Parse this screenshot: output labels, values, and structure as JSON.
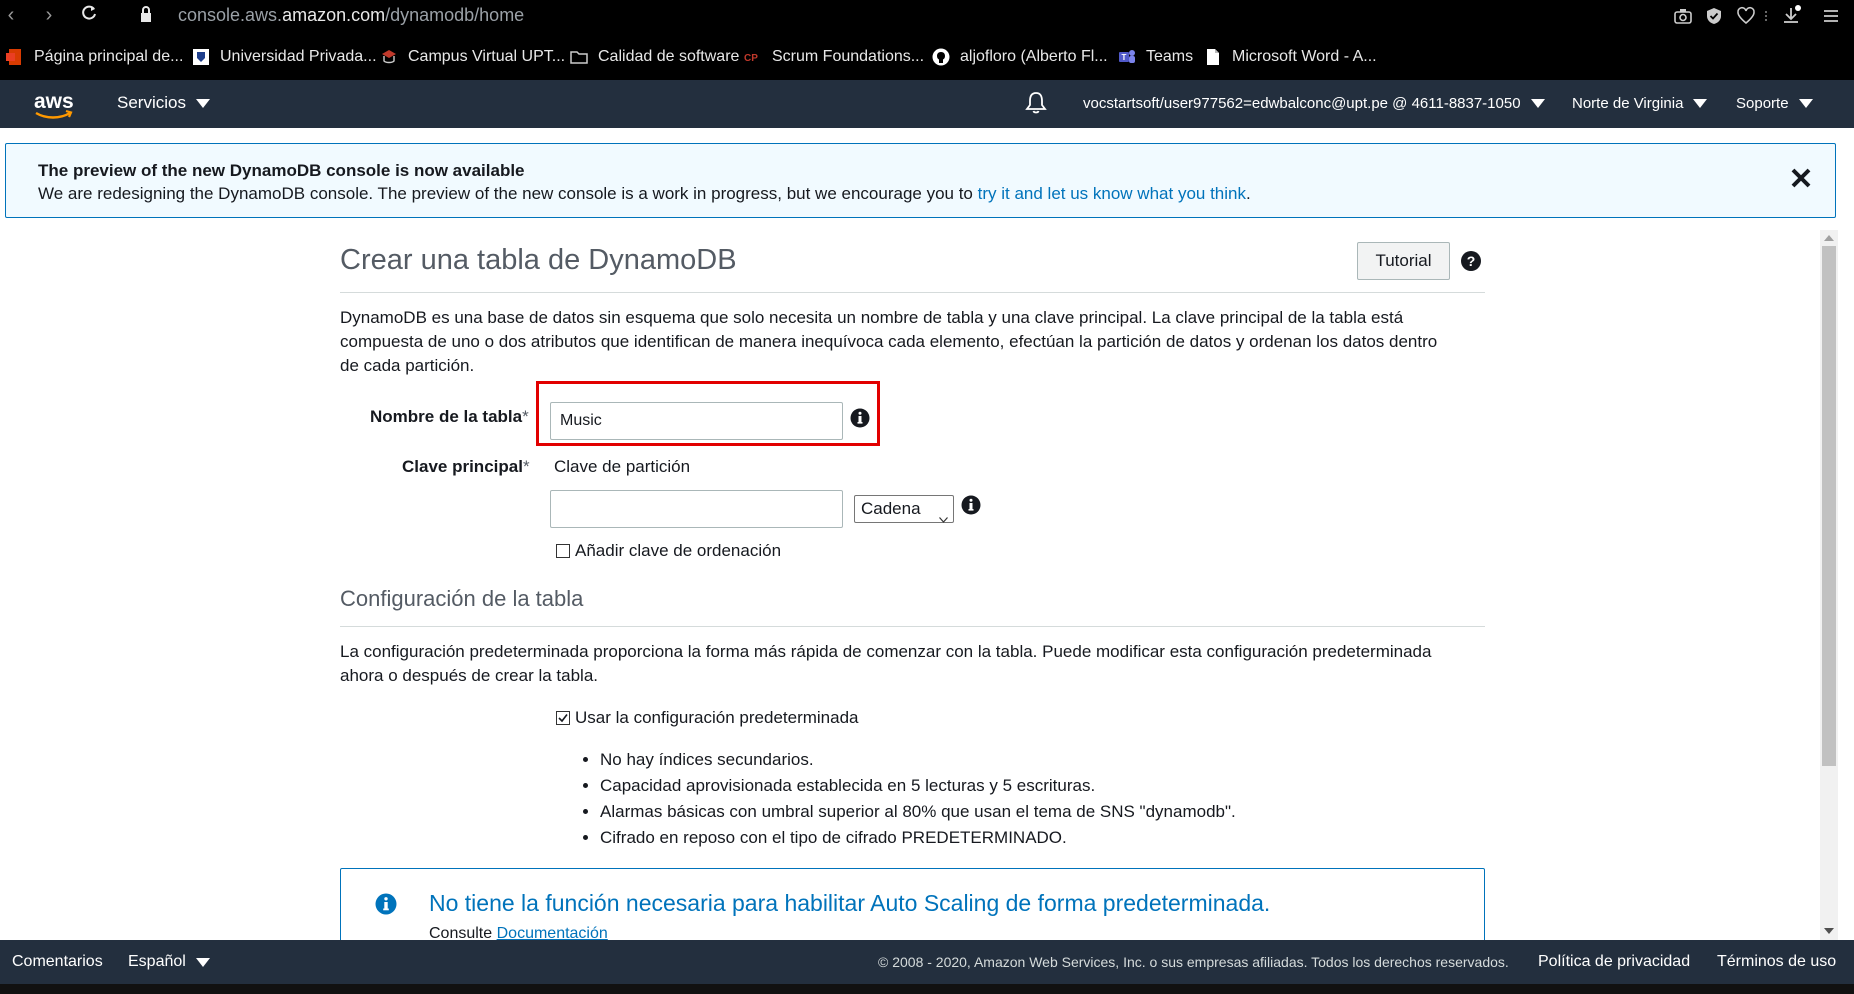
{
  "browser": {
    "url_prefix": "console.aws.",
    "url_domain": "amazon.com",
    "url_path": "/dynamodb/home",
    "bookmarks": [
      {
        "label": "Página principal de...",
        "icon": "office-icon"
      },
      {
        "label": "Universidad Privada...",
        "icon": "university-crest-icon"
      },
      {
        "label": "Campus Virtual UPT...",
        "icon": "campus-icon"
      },
      {
        "label": "Calidad de software",
        "icon": "folder-icon"
      },
      {
        "label": "Scrum Foundations...",
        "icon": "cp-icon"
      },
      {
        "label": "aljofloro (Alberto Fl...",
        "icon": "github-icon"
      },
      {
        "label": "Teams",
        "icon": "teams-icon"
      },
      {
        "label": "Microsoft Word - A...",
        "icon": "document-icon"
      }
    ]
  },
  "aws_nav": {
    "logo_text": "aws",
    "services": "Servicios",
    "account": "vocstartsoft/user977562=edwbalconc@upt.pe @ 4611-8837-1050",
    "region": "Norte de Virginia",
    "support": "Soporte"
  },
  "banner": {
    "title": "The preview of the new DynamoDB console is now available",
    "text": "We are redesigning the DynamoDB console. The preview of the new console is a work in progress, but we encourage you to",
    "link": "try it and let us know what you think",
    "period": "."
  },
  "page": {
    "title": "Crear una tabla de DynamoDB",
    "tutorial_button": "Tutorial",
    "description_lines": [
      "DynamoDB es una base de datos sin esquema que solo necesita un nombre de tabla y una clave principal. La clave principal de la tabla está",
      "compuesta de uno o dos atributos que identifican de manera inequívoca cada elemento, efectúan la partición de datos y ordenan los datos dentro",
      "de cada partición."
    ]
  },
  "form": {
    "table_name_label": "Nombre de la tabla",
    "table_name_value": "Music",
    "required_mark": "*",
    "primary_key_label": "Clave principal",
    "partition_key_label": "Clave de partición",
    "partition_key_value": "",
    "type_select_value": "Cadena",
    "add_sort_key_label": "Añadir clave de ordenación"
  },
  "table_config": {
    "title": "Configuración de la tabla",
    "description_lines": [
      "La configuración predeterminada proporciona la forma más rápida de comenzar con la tabla. Puede modificar esta configuración predeterminada",
      "ahora o después de crear la tabla."
    ],
    "use_defaults_label": "Usar la configuración predeterminada",
    "use_defaults_checked": true,
    "defaults": [
      "No hay índices secundarios.",
      "Capacidad aprovisionada establecida en 5 lecturas y 5 escrituras.",
      "Alarmas básicas con umbral superior al 80% que usan el tema de SNS \"dynamodb\".",
      "Cifrado en reposo con el tipo de cifrado PREDETERMINADO."
    ]
  },
  "alert": {
    "title": "No tiene la función necesaria para habilitar Auto Scaling de forma predeterminada.",
    "sub_prefix": "Consulte",
    "sub_link": "Documentación"
  },
  "footer": {
    "feedback": "Comentarios",
    "language": "Español",
    "copyright": "© 2008 - 2020, Amazon Web Services, Inc. o sus empresas afiliadas. Todos los derechos reservados.",
    "privacy": "Política de privacidad",
    "terms": "Términos de uso"
  },
  "colors": {
    "aws_nav_bg": "#232f3e",
    "aws_orange": "#ff9900",
    "link_blue": "#0073bb",
    "highlight_red": "#e20000"
  }
}
